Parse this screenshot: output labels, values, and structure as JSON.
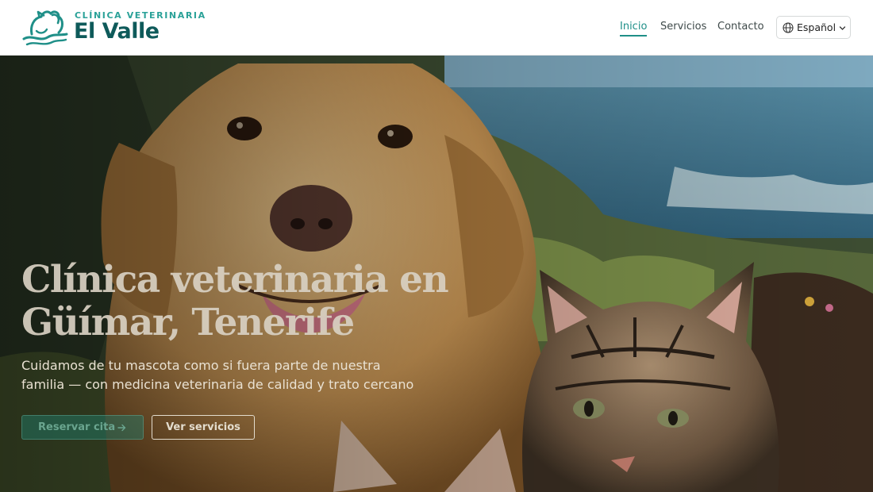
{
  "brand": {
    "subtitle": "CLÍNICA VETERINARIA",
    "name": "El Valle",
    "logo_icon": "dog-cat-wave-icon",
    "colors": {
      "teal": "#1f8f88",
      "dark_teal": "#0e5a5a"
    }
  },
  "nav": {
    "items": [
      {
        "label": "Inicio",
        "active": true
      },
      {
        "label": "Servicios",
        "active": false
      },
      {
        "label": "Contacto",
        "active": false
      }
    ],
    "language": {
      "label": "Español",
      "icon": "globe-icon",
      "caret": "chevron-down-icon"
    }
  },
  "hero": {
    "title_line1": "Clínica veterinaria en",
    "title_line2": "Güímar, Tenerife",
    "subtitle_line1": "Cuidamos de tu mascota como si fuera parte de nuestra",
    "subtitle_line2": "familia — con medicina veterinaria de calidad y trato cercano",
    "primary_button": "Reservar cita",
    "primary_icon": "arrow-right-icon",
    "secondary_button": "Ver servicios",
    "image": "golden-retriever-and-tabby-cat-coastal-photo"
  }
}
